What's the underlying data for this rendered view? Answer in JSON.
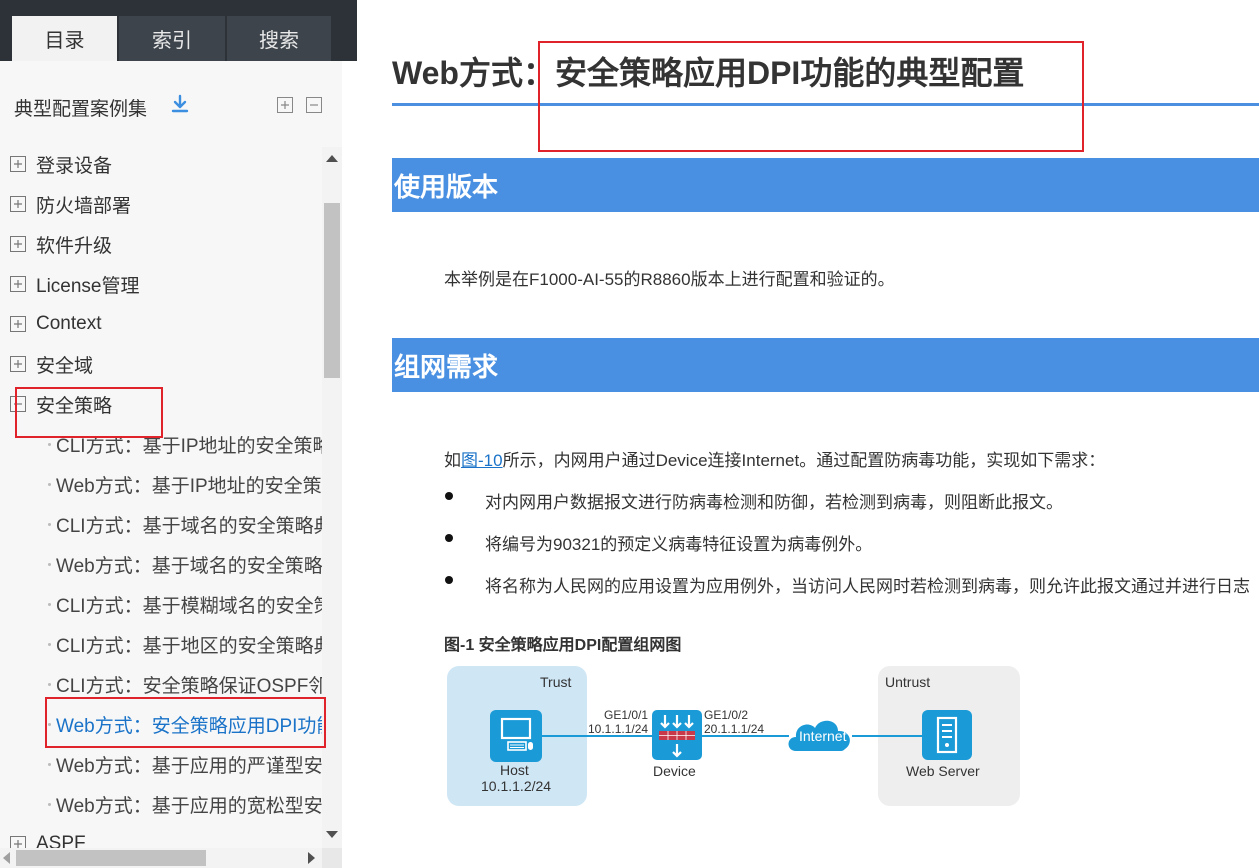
{
  "tabs": [
    {
      "label": "目录",
      "active": true
    },
    {
      "label": "索引",
      "active": false
    },
    {
      "label": "搜索",
      "active": false
    }
  ],
  "panel": {
    "title": "典型配置案例集",
    "icons": {
      "download": "download-icon",
      "expand": "expand-all-icon",
      "collapse": "collapse-all-icon"
    }
  },
  "tree": {
    "nodes": [
      {
        "label": "登录设备",
        "state": "collapsed"
      },
      {
        "label": "防火墙部署",
        "state": "collapsed"
      },
      {
        "label": "软件升级",
        "state": "collapsed"
      },
      {
        "label": "License管理",
        "state": "collapsed"
      },
      {
        "label": "Context",
        "state": "collapsed"
      },
      {
        "label": "安全域",
        "state": "collapsed"
      },
      {
        "label": "安全策略",
        "state": "expanded"
      }
    ],
    "children": [
      {
        "label": "CLI方式：基于IP地址的安全策略"
      },
      {
        "label": "Web方式：基于IP地址的安全策略"
      },
      {
        "label": "CLI方式：基于域名的安全策略典"
      },
      {
        "label": "Web方式：基于域名的安全策略"
      },
      {
        "label": "CLI方式：基于模糊域名的安全策"
      },
      {
        "label": "CLI方式：基于地区的安全策略典"
      },
      {
        "label": "CLI方式：安全策略保证OSPF邻居"
      },
      {
        "label": "Web方式：安全策略应用DPI功能",
        "selected": true
      },
      {
        "label": "Web方式：基于应用的严谨型安"
      },
      {
        "label": "Web方式：基于应用的宽松型安"
      }
    ],
    "next_node": {
      "label": "ASPF",
      "state": "collapsed"
    }
  },
  "doc": {
    "title": "Web方式：安全策略应用DPI功能的典型配置",
    "sections": [
      {
        "heading": "使用版本",
        "text": "本举例是在F1000-AI-55的R8860版本上进行配置和验证的。"
      },
      {
        "heading": "组网需求"
      }
    ],
    "intro_prefix": "如",
    "intro_link": "图-10",
    "intro_suffix": "所示，内网用户通过Device连接Internet。通过配置防病毒功能，实现如下需求：",
    "bullets": [
      "对内网用户数据报文进行防病毒检测和防御，若检测到病毒，则阻断此报文。",
      "将编号为90321的预定义病毒特征设置为病毒例外。",
      "将名称为人民网的应用设置为应用例外，当访问人民网时若检测到病毒，则允许此报文通过并进行日志"
    ],
    "figure_caption": "图-1 安全策略应用DPI配置组网图",
    "diagram": {
      "trust_label": "Trust",
      "untrust_label": "Untrust",
      "host_label": "Host",
      "host_ip": "10.1.1.2/24",
      "if1": "GE1/0/1",
      "if1_ip": "10.1.1.1/24",
      "if2": "GE1/0/2",
      "if2_ip": "20.1.1.1/24",
      "device_label": "Device",
      "internet_label": "Internet",
      "server_label": "Web Server"
    }
  },
  "colors": {
    "section_bar": "#4a90e2",
    "link": "#1a73c8",
    "highlight_box": "#e0232a",
    "trust_zone": "#cfe6f5",
    "untrust_zone": "#eeeeee",
    "device_blue": "#1a9ad6"
  }
}
